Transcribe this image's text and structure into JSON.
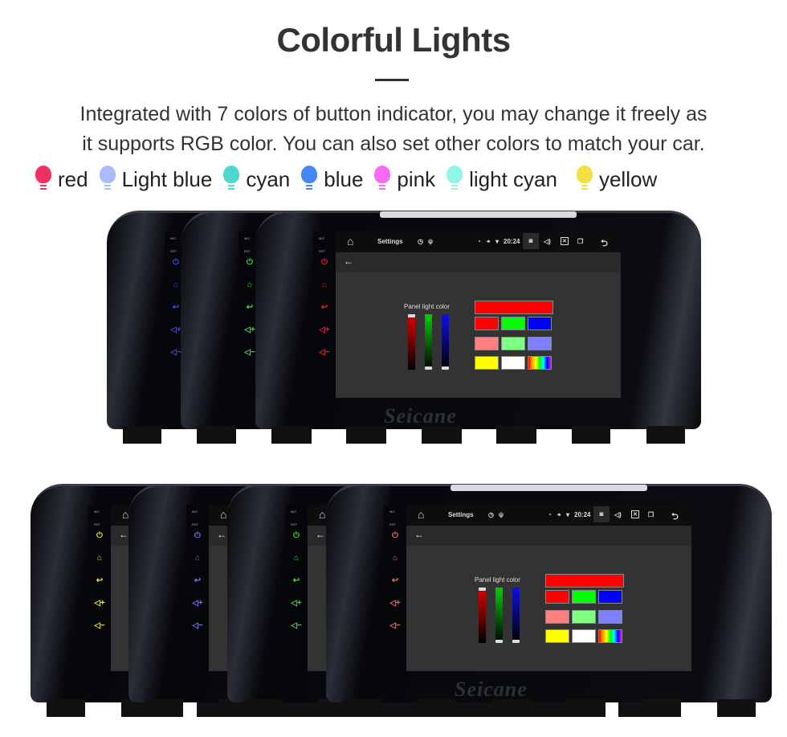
{
  "header": {
    "title": "Colorful Lights",
    "description_lines": [
      "Integrated with 7 colors of button indicator, you may change it freely as",
      "it supports RGB color. You can also set other colors to match your car."
    ]
  },
  "legend": [
    {
      "label": "red",
      "color": "#f0305f"
    },
    {
      "label": "Light blue",
      "color": "#aabcf8"
    },
    {
      "label": "cyan",
      "color": "#4fd6d2"
    },
    {
      "label": "blue",
      "color": "#4487f5"
    },
    {
      "label": "pink",
      "color": "#f86af4"
    },
    {
      "label": "light cyan",
      "color": "#8ff5e6"
    },
    {
      "label": "yellow",
      "color": "#f2e040"
    }
  ],
  "screen": {
    "app_title": "Settings",
    "time": "20:24",
    "panel_label": "Panel light color",
    "strip_labels": [
      "MIC",
      "RST"
    ],
    "watermark": "Seicane",
    "icons": [
      "home-icon",
      "timer-icon",
      "usb-icon",
      "alarm-icon",
      "location-icon",
      "wifi-icon",
      "camera-icon",
      "volume-icon",
      "close-box-icon",
      "recent-apps-icon",
      "back-icon",
      "arrow-left-icon"
    ],
    "slider_levels": {
      "red": 1.0,
      "green": 0.0,
      "blue": 0.0
    },
    "swatches": [
      "#ff0000",
      "#00ff00",
      "#0000ff",
      "#ff8080",
      "#80ff80",
      "#8080ff",
      "#ffff00",
      "#ffffff",
      "rainbow"
    ],
    "selected_color": "#ff0000"
  },
  "units": {
    "top_indicator_colors": [
      "#3b4cff",
      "#3ddc4a",
      "#e8232f"
    ],
    "bottom_indicator_colors": [
      "#e8e81a",
      "#7a74f0",
      "#3fd84a",
      "#ef6a6a"
    ]
  }
}
